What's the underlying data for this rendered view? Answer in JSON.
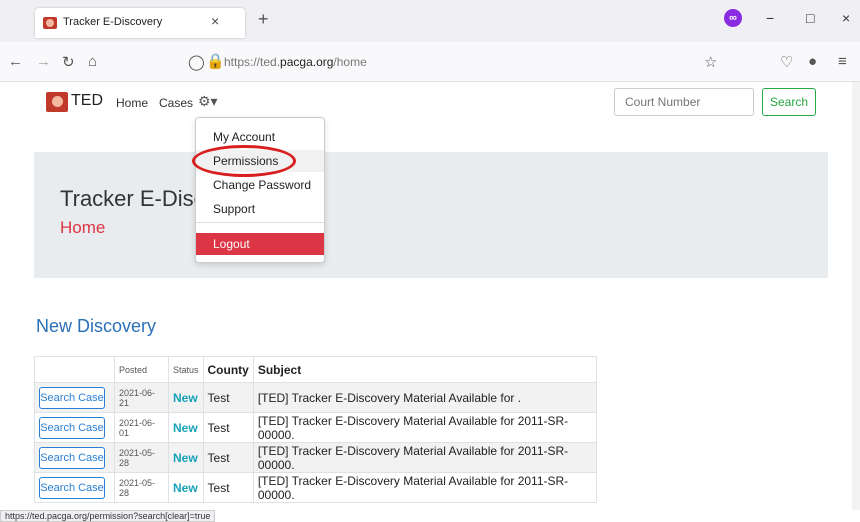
{
  "browser": {
    "tab_title": "Tracker E-Discovery",
    "tab_close": "×",
    "new_tab": "+",
    "url_prefix": "https://ted.",
    "url_domain": "pacga.org",
    "url_path": "/home",
    "window_min": "−",
    "window_max": "□",
    "window_close": "×",
    "icons": [
      "back-icon",
      "forward-icon",
      "reload-icon",
      "home-icon",
      "shield-icon",
      "lock-icon",
      "star-icon",
      "pocket-icon",
      "extension-icon",
      "menu-icon"
    ]
  },
  "site": {
    "brand": "TED",
    "nav": {
      "home": "Home",
      "cases": "Cases"
    },
    "court_placeholder": "Court Number",
    "search_label": "Search"
  },
  "dropdown": {
    "items": [
      "My Account",
      "Permissions",
      "Change Password",
      "Support"
    ],
    "logout": "Logout"
  },
  "jumbotron": {
    "title": "Tracker E-Discovery",
    "subtitle": "Home"
  },
  "section_title": "New Discovery",
  "table": {
    "headers": [
      "Posted",
      "Status",
      "County",
      "Subject"
    ],
    "button_label": "Search Case",
    "rows": [
      {
        "posted": "2021-06-21",
        "status": "New",
        "county": "Test",
        "subject": "[TED] Tracker E-Discovery Material Available for ."
      },
      {
        "posted": "2021-06-01",
        "status": "New",
        "county": "Test",
        "subject": "[TED] Tracker E-Discovery Material Available for 2011-SR-00000."
      },
      {
        "posted": "2021-05-28",
        "status": "New",
        "county": "Test",
        "subject": "[TED] Tracker E-Discovery Material Available for 2011-SR-00000."
      },
      {
        "posted": "2021-05-28",
        "status": "New",
        "county": "Test",
        "subject": "[TED] Tracker E-Discovery Material Available for 2011-SR-00000."
      }
    ]
  },
  "status_url": "https://ted.pacga.org/permission?search[clear]=true",
  "colors": {
    "accent": "#2a6fb8",
    "danger": "#dc3545",
    "success": "#28a745",
    "info": "#17a2b8"
  }
}
